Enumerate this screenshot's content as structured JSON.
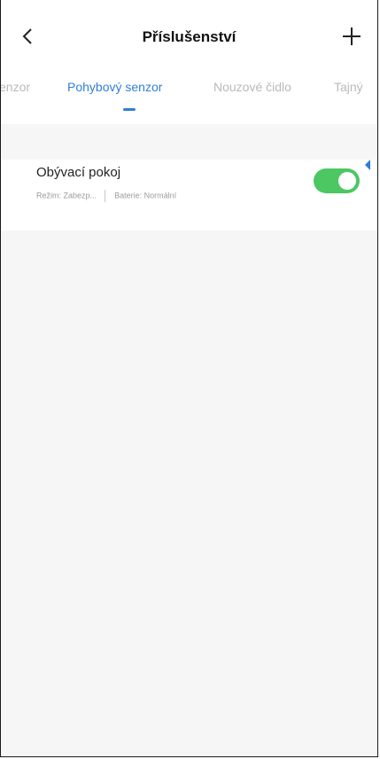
{
  "header": {
    "title": "Příslušenství"
  },
  "tabs": [
    {
      "label": "enzor",
      "active": false
    },
    {
      "label": "Pohybový senzor",
      "active": true
    },
    {
      "label": "Nouzové čidlo",
      "active": false
    },
    {
      "label": "Tajný",
      "active": false
    }
  ],
  "devices": [
    {
      "name": "Obývací pokoj",
      "mode": "Režim:  Zabezp...",
      "battery": "Baterie: Normální",
      "enabled": true
    }
  ],
  "colors": {
    "accent": "#2f7fd6",
    "toggle_on": "#4cc761",
    "tab_inactive": "#b9b9b9",
    "background": "#f6f6f6"
  },
  "icons": {
    "back": "back-arrow-icon",
    "add": "plus-icon"
  }
}
